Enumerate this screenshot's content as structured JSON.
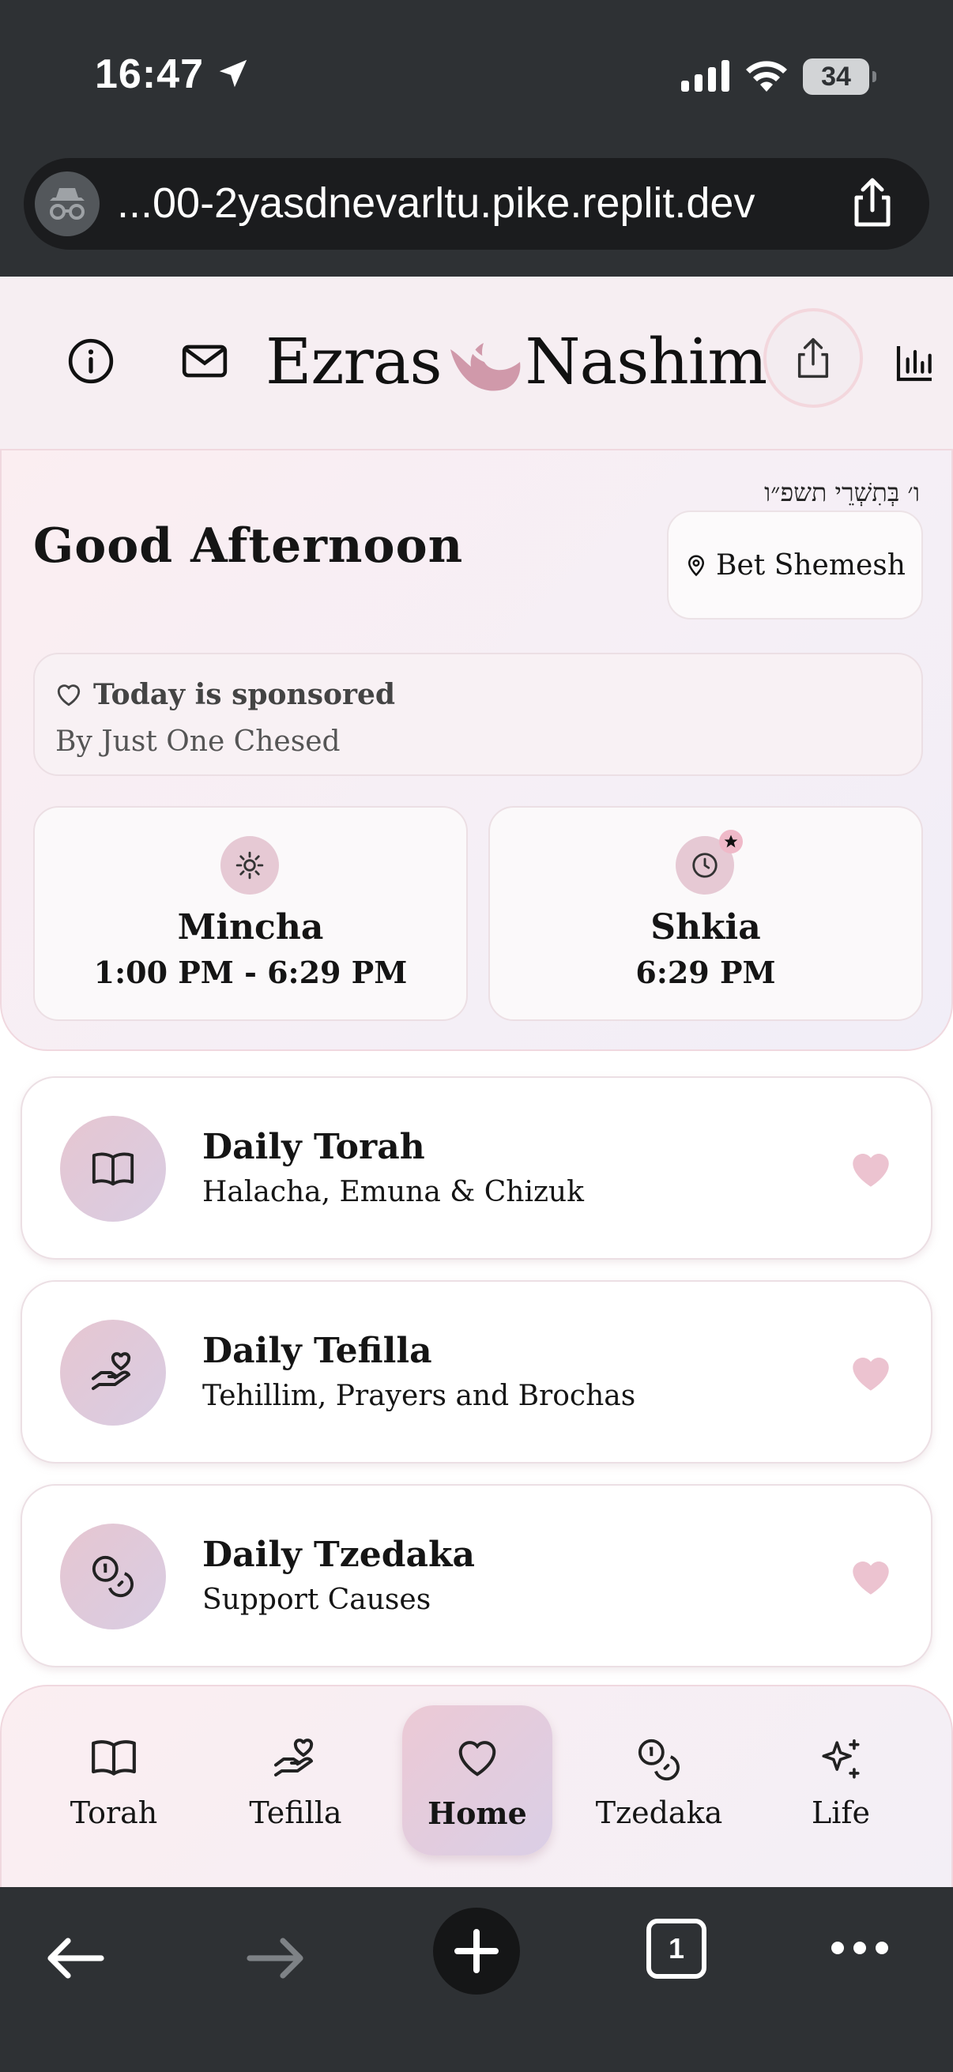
{
  "status_bar": {
    "time": "16:47",
    "battery": "34"
  },
  "browser": {
    "url": "...00-2yasdnevarltu.pike.replit.dev",
    "tab_count": "1"
  },
  "header": {
    "logo_left": "Ezras",
    "logo_right": "Nashim"
  },
  "hero": {
    "hebrew_date": "ו׳ בְּתִשְׁרֵי תשפ״ו",
    "greeting": "Good Afternoon",
    "location": "Bet Shemesh",
    "sponsor_title": "Today is sponsored",
    "sponsor_by": "By Just One Chesed",
    "times": [
      {
        "title": "Mincha",
        "value": "1:00 PM - 6:29 PM"
      },
      {
        "title": "Shkia",
        "value": "6:29 PM"
      }
    ]
  },
  "features": [
    {
      "title": "Daily Torah",
      "subtitle": "Halacha, Emuna & Chizuk"
    },
    {
      "title": "Daily Tefilla",
      "subtitle": "Tehillim, Prayers and Brochas"
    },
    {
      "title": "Daily Tzedaka",
      "subtitle": "Support Causes"
    }
  ],
  "tabs": [
    {
      "label": "Torah"
    },
    {
      "label": "Tefilla"
    },
    {
      "label": "Home"
    },
    {
      "label": "Tzedaka"
    },
    {
      "label": "Life"
    }
  ],
  "colors": {
    "accent_pink": "#e6c6d1",
    "accent_lavender": "#d9cde3",
    "heart": "#ecc3d0",
    "logo_mark": "#c98a9e"
  }
}
